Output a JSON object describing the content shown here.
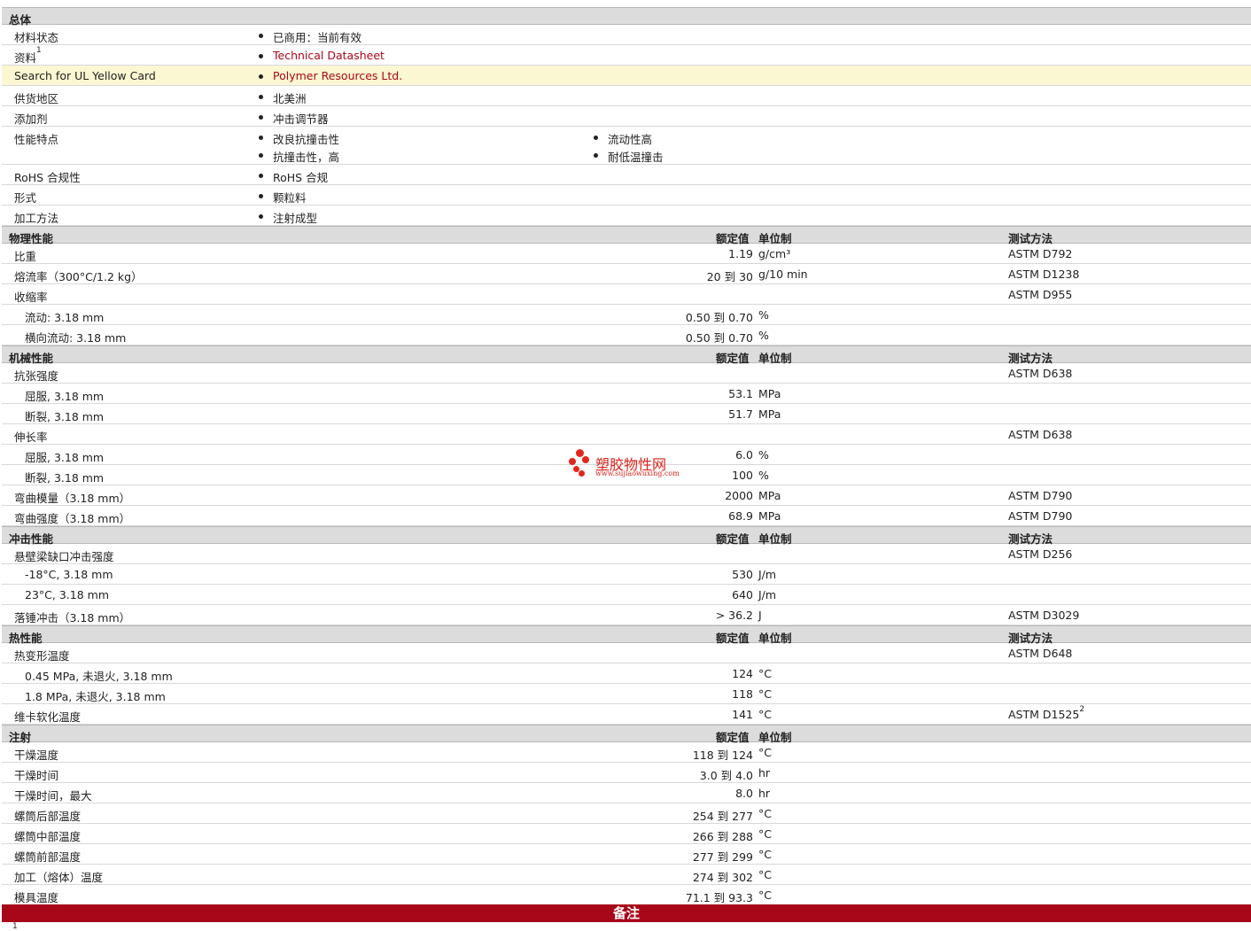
{
  "general": {
    "title": "总体",
    "rows": [
      {
        "label": "材料状态",
        "items": [
          "已商用：当前有效"
        ]
      },
      {
        "label": "资料",
        "sup": "1",
        "items": [
          "Technical Datasheet"
        ],
        "link": true
      },
      {
        "label": "Search for UL Yellow Card",
        "items": [
          "Polymer Resources Ltd."
        ],
        "link": true,
        "highlight": true
      },
      {
        "label": "供货地区",
        "items": [
          "北美洲"
        ]
      },
      {
        "label": "添加剂",
        "items": [
          "冲击调节器"
        ]
      },
      {
        "label": "性能特点",
        "items": [
          "改良抗撞击性",
          "抗撞击性，高"
        ],
        "items2": [
          "流动性高",
          "耐低温撞击"
        ]
      },
      {
        "label": "RoHS 合规性",
        "items": [
          "RoHS 合规"
        ]
      },
      {
        "label": "形式",
        "items": [
          "颗粒料"
        ]
      },
      {
        "label": "加工方法",
        "items": [
          "注射成型"
        ]
      }
    ]
  },
  "sections": [
    {
      "title": "物理性能",
      "h_value": "额定值",
      "h_unit": "单位制",
      "h_method": "测试方法",
      "rows": [
        {
          "label": "比重",
          "value": "1.19",
          "unit": "g/cm³",
          "method": "ASTM D792"
        },
        {
          "label": "熔流率（300°C/1.2 kg）",
          "value": "20 到  30",
          "unit": "g/10 min",
          "method": "ASTM D1238"
        },
        {
          "label": "收缩率",
          "value": "",
          "unit": "",
          "method": "ASTM D955"
        },
        {
          "label": "流动: 3.18 mm",
          "sub": true,
          "value": "0.50 到  0.70",
          "unit": "%",
          "method": ""
        },
        {
          "label": "横向流动: 3.18 mm",
          "sub": true,
          "value": "0.50 到  0.70",
          "unit": "%",
          "method": ""
        }
      ]
    },
    {
      "title": "机械性能",
      "h_value": "额定值",
      "h_unit": "单位制",
      "h_method": "测试方法",
      "rows": [
        {
          "label": "抗张强度",
          "value": "",
          "unit": "",
          "method": "ASTM D638"
        },
        {
          "label": "屈服, 3.18 mm",
          "sub": true,
          "value": "53.1",
          "unit": "MPa",
          "method": ""
        },
        {
          "label": "断裂, 3.18 mm",
          "sub": true,
          "value": "51.7",
          "unit": "MPa",
          "method": ""
        },
        {
          "label": "伸长率",
          "value": "",
          "unit": "",
          "method": "ASTM D638"
        },
        {
          "label": "屈服, 3.18 mm",
          "sub": true,
          "value": "6.0",
          "unit": "%",
          "method": ""
        },
        {
          "label": "断裂, 3.18 mm",
          "sub": true,
          "value": "100",
          "unit": "%",
          "method": ""
        },
        {
          "label": "弯曲模量（3.18 mm）",
          "value": "2000",
          "unit": "MPa",
          "method": "ASTM D790"
        },
        {
          "label": "弯曲强度（3.18 mm）",
          "value": "68.9",
          "unit": "MPa",
          "method": "ASTM D790"
        }
      ]
    },
    {
      "title": "冲击性能",
      "h_value": "额定值",
      "h_unit": "单位制",
      "h_method": "测试方法",
      "rows": [
        {
          "label": "悬壁梁缺口冲击强度",
          "value": "",
          "unit": "",
          "method": "ASTM D256"
        },
        {
          "label": "-18°C, 3.18 mm",
          "sub": true,
          "value": "530",
          "unit": "J/m",
          "method": ""
        },
        {
          "label": "23°C, 3.18 mm",
          "sub": true,
          "value": "640",
          "unit": "J/m",
          "method": ""
        },
        {
          "label": "落锤冲击（3.18 mm）",
          "value": "> 36.2",
          "unit": "J",
          "method": "ASTM D3029"
        }
      ]
    },
    {
      "title": "热性能",
      "h_value": "额定值",
      "h_unit": "单位制",
      "h_method": "测试方法",
      "rows": [
        {
          "label": "热变形温度",
          "value": "",
          "unit": "",
          "method": "ASTM D648"
        },
        {
          "label": "0.45 MPa, 未退火, 3.18 mm",
          "sub": true,
          "value": "124",
          "unit": "°C",
          "method": ""
        },
        {
          "label": "1.8 MPa, 未退火, 3.18 mm",
          "sub": true,
          "value": "118",
          "unit": "°C",
          "method": ""
        },
        {
          "label": "维卡软化温度",
          "value": "141",
          "unit": "°C",
          "method": "ASTM D1525",
          "method_sup": "2"
        }
      ]
    },
    {
      "title": "注射",
      "h_value": "额定值",
      "h_unit": "单位制",
      "h_method": "",
      "rows": [
        {
          "label": "干燥温度",
          "value": "118 到  124",
          "unit": "°C",
          "method": ""
        },
        {
          "label": "干燥时间",
          "value": "3.0 到  4.0",
          "unit": "hr",
          "method": ""
        },
        {
          "label": "干燥时间，最大",
          "value": "8.0",
          "unit": "hr",
          "method": ""
        },
        {
          "label": "螺筒后部温度",
          "value": "254 到  277",
          "unit": "°C",
          "method": ""
        },
        {
          "label": "螺筒中部温度",
          "value": "266 到  288",
          "unit": "°C",
          "method": ""
        },
        {
          "label": "螺筒前部温度",
          "value": "277 到  299",
          "unit": "°C",
          "method": ""
        },
        {
          "label": "加工（熔体）温度",
          "value": "274 到  302",
          "unit": "°C",
          "method": ""
        },
        {
          "label": "模具温度",
          "value": "71.1 到  93.3",
          "unit": "°C",
          "method": ""
        }
      ]
    }
  ],
  "notes": {
    "title": "备注",
    "first_marker": "1"
  },
  "watermark": {
    "name": "塑胶物性网",
    "url": "www.sujiaowuxing.com"
  },
  "colors": {
    "accent": "#a8071a",
    "section_header_bg": "#dcdcdc",
    "highlight_row_bg": "#fbf7d2"
  }
}
